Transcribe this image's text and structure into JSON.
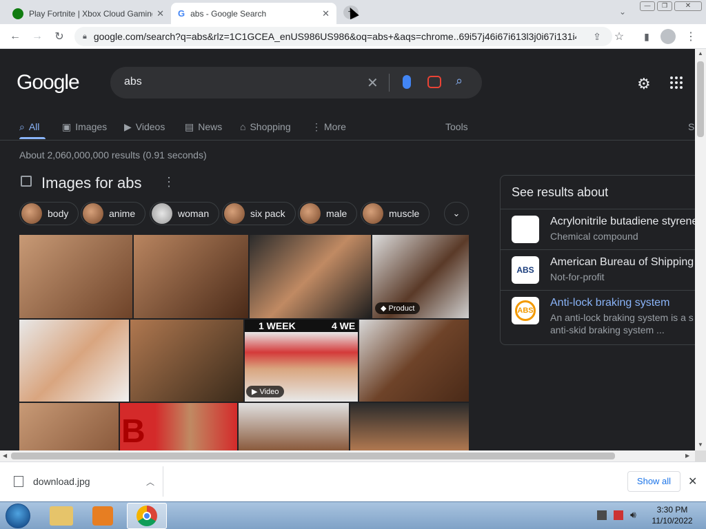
{
  "browser": {
    "tabs": [
      {
        "title": "Play Fortnite | Xbox Cloud Gaming",
        "active": false
      },
      {
        "title": "abs - Google Search",
        "active": true
      }
    ],
    "url": "google.com/search?q=abs&rlz=1C1GCEA_enUS986US986&oq=abs+&aqs=chrome..69i57j46i67i613l3j0i67i131i4..."
  },
  "google": {
    "logo": "Google",
    "query": "abs",
    "nav": [
      {
        "label": "All",
        "active": true
      },
      {
        "label": "Images"
      },
      {
        "label": "Videos"
      },
      {
        "label": "News"
      },
      {
        "label": "Shopping"
      },
      {
        "label": "More"
      }
    ],
    "tools": "Tools",
    "cut_tab": "S",
    "stats": "About 2,060,000,000 results (0.91 seconds)",
    "images_heading": "Images for abs",
    "chips": [
      "body",
      "anime",
      "woman",
      "six pack",
      "male",
      "muscle"
    ],
    "overlays": {
      "product": "Product",
      "video": "Video",
      "week1": "1 WEEK",
      "week4": "4 WE",
      "red_letter": "B"
    }
  },
  "knowledge": {
    "heading": "See results about",
    "items": [
      {
        "title": "Acrylonitrile butadiene styrene",
        "subtitle": "Chemical compound",
        "link": false
      },
      {
        "title": "American Bureau of Shipping",
        "subtitle": "Not-for-profit",
        "link": false
      },
      {
        "title": "Anti-lock braking system",
        "subtitle": "An anti-lock braking system is a s",
        "subtitle2": "anti-skid braking system ...",
        "link": true
      }
    ],
    "abs_logo": "ABS",
    "abs_logo2": "ABS"
  },
  "downloads": {
    "file": "download.jpg",
    "show_all": "Show all"
  },
  "taskbar": {
    "time": "3:30 PM",
    "date": "11/10/2022"
  },
  "colors": {
    "link": "#8ab4f8",
    "accent": "#8ab4f8",
    "page_bg": "#202124"
  }
}
